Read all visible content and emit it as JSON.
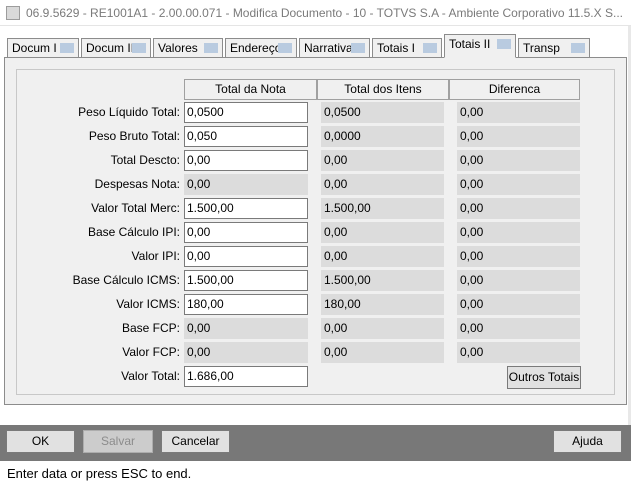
{
  "window": {
    "title": "06.9.5629 - RE1001A1 - 2.00.00.071 - Modifica Documento - 10 - TOTVS S.A - Ambiente Corporativo 11.5.X S..."
  },
  "tabs": [
    {
      "label": "Docum I",
      "active": false
    },
    {
      "label": "Docum II",
      "active": false
    },
    {
      "label": "Valores",
      "active": false
    },
    {
      "label": "Endereço",
      "active": false
    },
    {
      "label": "Narrativa",
      "active": false
    },
    {
      "label": "Totais I",
      "active": false
    },
    {
      "label": "Totais II",
      "active": true
    },
    {
      "label": "Transp",
      "active": false
    }
  ],
  "columns": {
    "total_nota": "Total da Nota",
    "total_itens": "Total dos Itens",
    "diferenca": "Diferenca"
  },
  "rows": [
    {
      "label": "Peso Líquido Total:",
      "nota": "0,0500",
      "itens": "0,0500",
      "dif": "0,00",
      "nota_editable": true
    },
    {
      "label": "Peso Bruto Total:",
      "nota": "0,050",
      "itens": "0,0000",
      "dif": "0,00",
      "nota_editable": true
    },
    {
      "label": "Total Descto:",
      "nota": "0,00",
      "itens": "0,00",
      "dif": "0,00",
      "nota_editable": true
    },
    {
      "label": "Despesas Nota:",
      "nota": "0,00",
      "itens": "0,00",
      "dif": "0,00",
      "nota_editable": false
    },
    {
      "label": "Valor Total Merc:",
      "nota": "1.500,00",
      "itens": "1.500,00",
      "dif": "0,00",
      "nota_editable": true
    },
    {
      "label": "Base Cálculo IPI:",
      "nota": "0,00",
      "itens": "0,00",
      "dif": "0,00",
      "nota_editable": true
    },
    {
      "label": "Valor IPI:",
      "nota": "0,00",
      "itens": "0,00",
      "dif": "0,00",
      "nota_editable": true
    },
    {
      "label": "Base Cálculo ICMS:",
      "nota": "1.500,00",
      "itens": "1.500,00",
      "dif": "0,00",
      "nota_editable": true
    },
    {
      "label": "Valor ICMS:",
      "nota": "180,00",
      "itens": "180,00",
      "dif": "0,00",
      "nota_editable": true
    },
    {
      "label": "Base FCP:",
      "nota": "0,00",
      "itens": "0,00",
      "dif": "0,00",
      "nota_editable": false
    },
    {
      "label": "Valor FCP:",
      "nota": "0,00",
      "itens": "0,00",
      "dif": "0,00",
      "nota_editable": false
    }
  ],
  "valor_total": {
    "label": "Valor Total:",
    "value": "1.686,00"
  },
  "buttons": {
    "outros_totais": "Outros Totais",
    "ok": "OK",
    "salvar": "Salvar",
    "cancelar": "Cancelar",
    "ajuda": "Ajuda"
  },
  "status": {
    "text": "Enter data or press ESC to end."
  }
}
